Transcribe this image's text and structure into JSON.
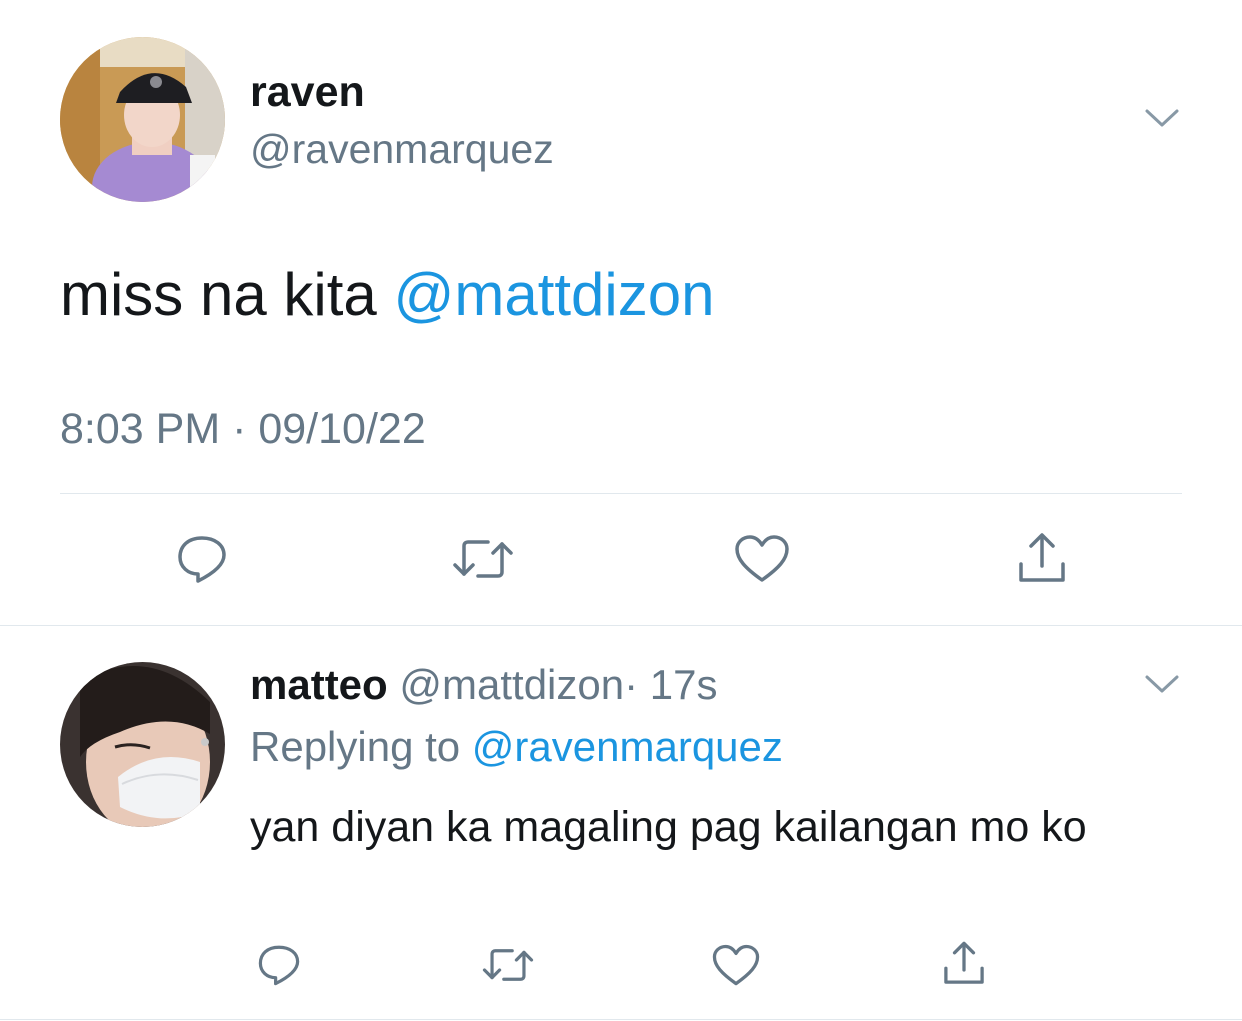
{
  "main_tweet": {
    "author": {
      "name": "raven",
      "handle": "@ravenmarquez"
    },
    "text": "miss na kita",
    "mention": "@mattdizon",
    "timestamp": "8:03 PM · 09/10/22",
    "actions": [
      "reply-icon",
      "retweet-icon",
      "like-icon",
      "share-icon"
    ]
  },
  "reply": {
    "author": {
      "name": "matteo",
      "handle": "@mattdizon",
      "time": "· 17s"
    },
    "replying_prefix": "Replying to",
    "replying_to": "@ravenmarquez",
    "text": "yan diyan ka magaling pag kailangan mo ko",
    "actions": [
      "reply-icon",
      "retweet-icon",
      "like-icon",
      "share-icon"
    ]
  },
  "colors": {
    "link": "#1b95e0",
    "muted": "#657786",
    "text": "#14171a",
    "divider": "#e1e8ed"
  }
}
